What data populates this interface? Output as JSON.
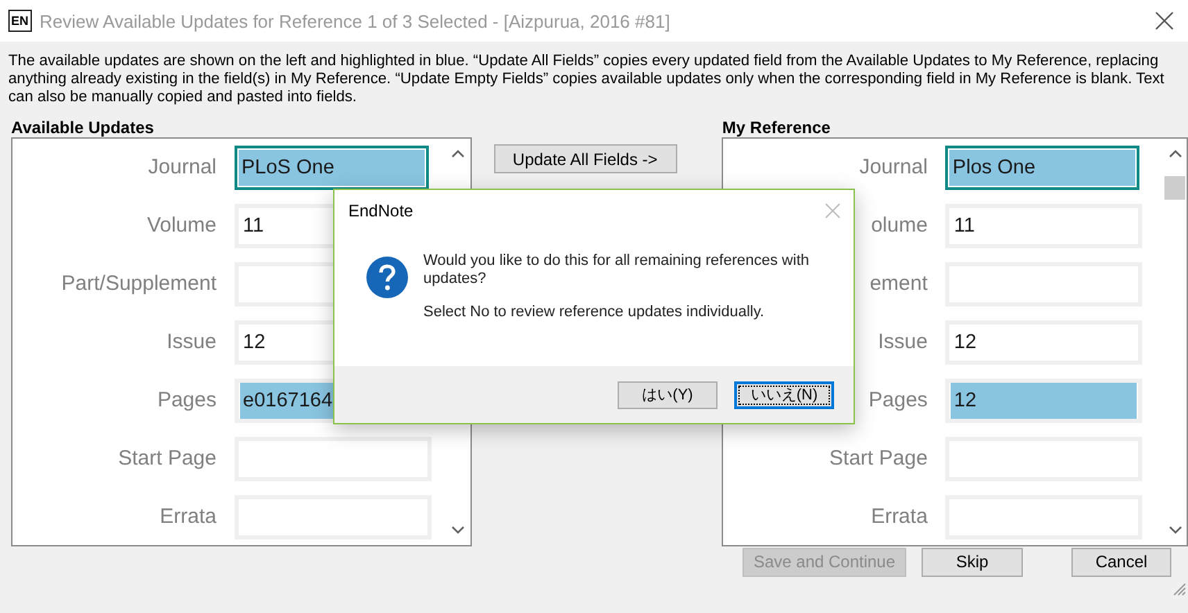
{
  "window": {
    "app_badge": "EN",
    "title": "Review Available Updates for Reference 1 of 3 Selected - [Aizpurua, 2016 #81]"
  },
  "description": "The available updates are shown on the left and highlighted in blue. “Update All Fields” copies every updated field from the Available Updates to My Reference, replacing anything already existing in the field(s) in My Reference. “Update Empty Fields” copies available updates only when the corresponding field in My Reference is blank. Text can also be manually copied and pasted into fields.",
  "available_updates": {
    "heading": "Available Updates",
    "fields": [
      {
        "label": "Journal",
        "value": "PLoS One",
        "highlighted": true,
        "focused": true
      },
      {
        "label": "Volume",
        "value": "11",
        "highlighted": false,
        "focused": false
      },
      {
        "label": "Part/Supplement",
        "highlighted": false,
        "focused": false
      },
      {
        "label": "Issue",
        "value": "12",
        "highlighted": false,
        "focused": false
      },
      {
        "label": "Pages",
        "value": "e0167164",
        "highlighted": true,
        "focused": false
      },
      {
        "label": "Start Page",
        "highlighted": false,
        "focused": false
      },
      {
        "label": "Errata",
        "highlighted": false,
        "focused": false
      }
    ]
  },
  "middle_buttons": [
    "Update All Fields ->"
  ],
  "my_reference": {
    "heading": "My Reference",
    "fields": [
      {
        "label": "Journal",
        "value": "Plos One",
        "highlighted": true,
        "focused": true
      },
      {
        "label": "olume",
        "value": "11",
        "highlighted": false,
        "focused": false
      },
      {
        "label": "ement",
        "highlighted": false,
        "focused": false
      },
      {
        "label": "Issue",
        "value": "12",
        "highlighted": false,
        "focused": false
      },
      {
        "label": "Pages",
        "value": "12",
        "highlighted": true,
        "focused": false
      },
      {
        "label": "Start Page",
        "highlighted": false,
        "focused": false
      },
      {
        "label": "Errata",
        "highlighted": false,
        "focused": false
      }
    ]
  },
  "footer_buttons": [
    {
      "label": "Save and Continue",
      "disabled": true
    },
    {
      "label": "Skip",
      "disabled": false
    },
    {
      "label": "Cancel",
      "disabled": false
    }
  ],
  "dialog": {
    "title": "EndNote",
    "message": "Would you like to do this for all remaining references with updates?",
    "hint": "Select No to review reference updates individually.",
    "buttons": [
      {
        "label": "はい(Y)",
        "selected": false
      },
      {
        "label": "いいえ(N)",
        "selected": true
      }
    ]
  }
}
